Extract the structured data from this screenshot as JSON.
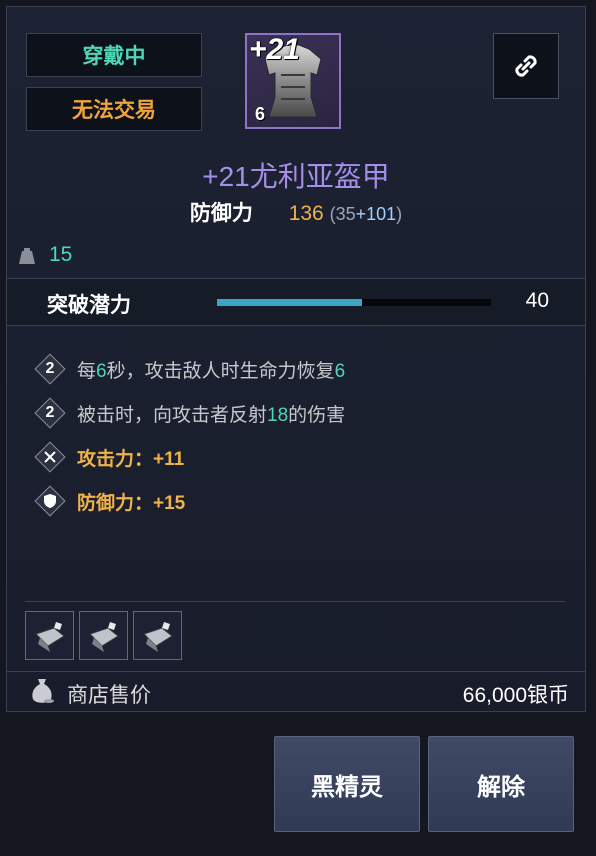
{
  "status_tags": {
    "equipped": "穿戴中",
    "untradable": "无法交易"
  },
  "item": {
    "enhance_level": "+21",
    "icon_level": "6",
    "name": "+21尤利亚盔甲",
    "defense_label": "防御力",
    "defense_value": "136",
    "defense_base": "35",
    "defense_bonus": "+101",
    "weight": "15"
  },
  "potential": {
    "label": "突破潜力",
    "value": "40",
    "fill_fraction": 0.53
  },
  "effects": [
    {
      "badge": "2",
      "pre": "每",
      "n1": "6",
      "mid": "秒，攻击敌人时生命力恢复",
      "n2": "6"
    },
    {
      "badge": "2",
      "pre": "被击时，向攻击者反射",
      "n1": "18",
      "mid": "的伤害"
    },
    {
      "icon": "crossed-swords-icon",
      "text": "攻击力：+11"
    },
    {
      "icon": "shield-icon",
      "text": "防御力：+15"
    }
  ],
  "gem_slots": [
    "gem-icon",
    "gem-icon",
    "gem-icon"
  ],
  "sell": {
    "label": "商店售价",
    "value": "66,000银币"
  },
  "buttons": {
    "dark_elf": "黑精灵",
    "release": "解除"
  },
  "colors": {
    "accent_teal": "#4fd6b4",
    "gold": "#f0b24a",
    "purple": "#a48ee8"
  }
}
